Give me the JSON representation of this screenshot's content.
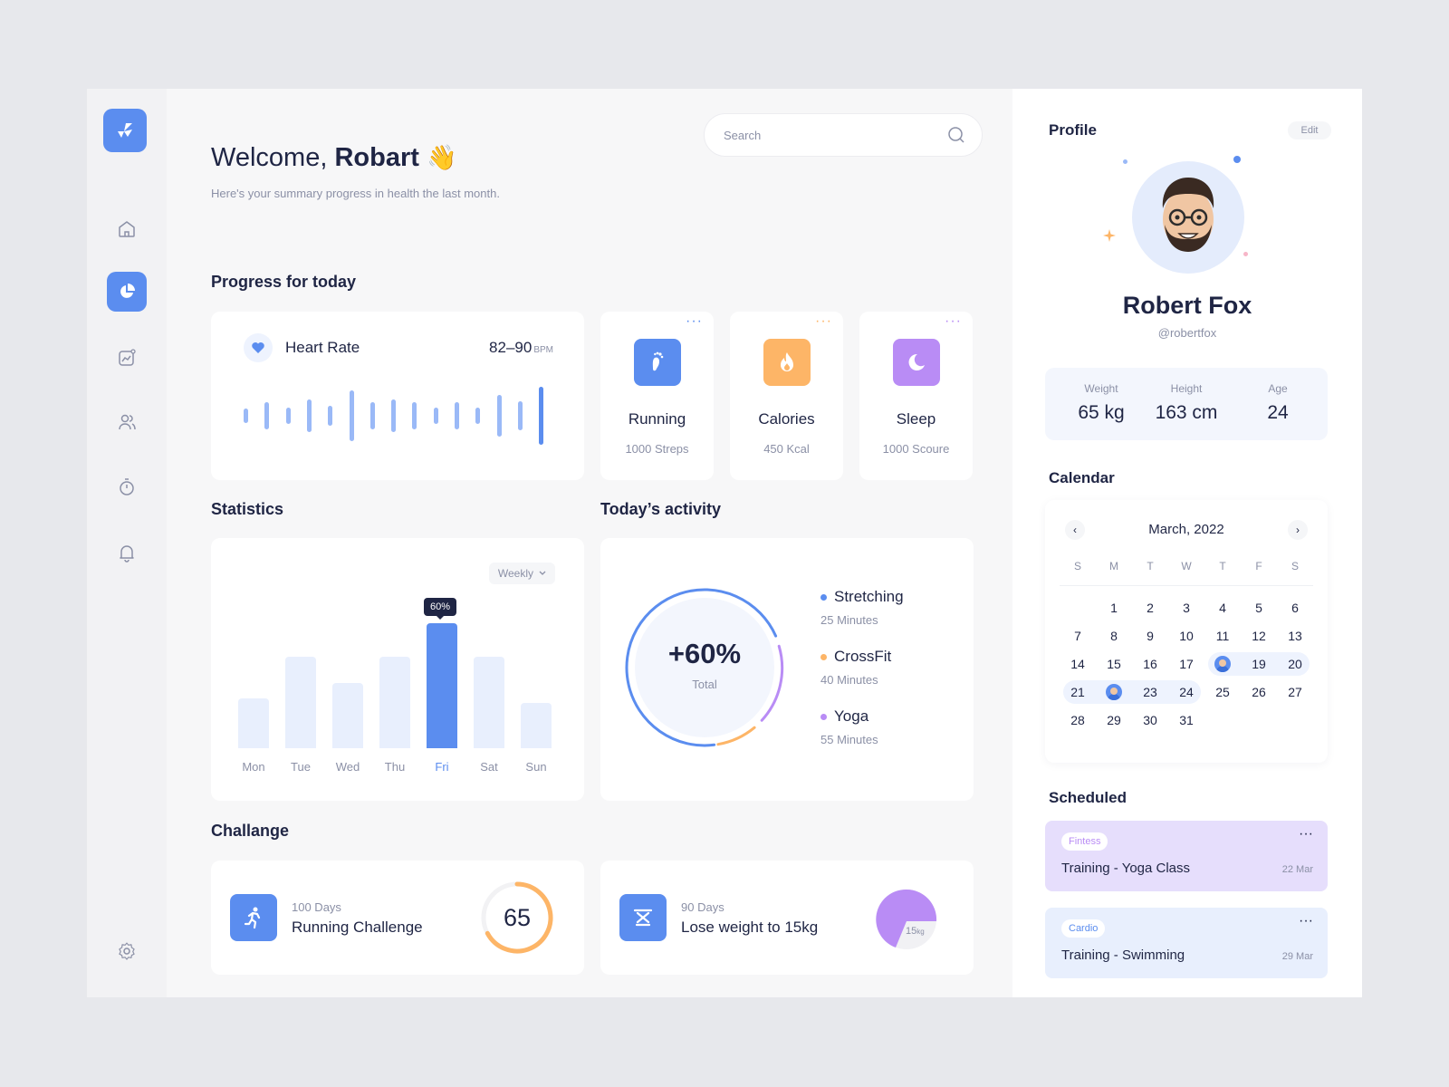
{
  "welcome": {
    "greeting": "Welcome,",
    "name": "Robart",
    "emoji": "👋",
    "subtitle": "Here's your summary progress in health the last month."
  },
  "search": {
    "placeholder": "Search"
  },
  "sidebar": {
    "items": [
      "home-icon",
      "pie-chart-icon",
      "trend-chart-icon",
      "users-icon",
      "timer-icon",
      "bell-icon",
      "settings-icon"
    ],
    "active": "pie-chart-icon"
  },
  "progress": {
    "title": "Progress for today",
    "heart_rate": {
      "label": "Heart Rate",
      "value": "82–90",
      "unit": "BPM"
    },
    "cards": [
      {
        "name": "Running",
        "value": "1000 Streps",
        "color": "#5b8def",
        "icon": "footprint-icon"
      },
      {
        "name": "Calories",
        "value": "450 Kcal",
        "color": "#fdb567",
        "icon": "fire-icon"
      },
      {
        "name": "Sleep",
        "value": "1000 Scoure",
        "color": "#b98cf5",
        "icon": "moon-icon"
      }
    ],
    "more": "···"
  },
  "statistics": {
    "title": "Statistics",
    "filter": "Weekly",
    "tooltip": "60%"
  },
  "chart_data": {
    "type": "bar",
    "categories": [
      "Mon",
      "Tue",
      "Wed",
      "Thu",
      "Fri",
      "Sat",
      "Sun"
    ],
    "values": [
      30,
      55,
      39,
      55,
      75,
      55,
      27
    ],
    "highlight": "Fri",
    "highlight_label": "60%"
  },
  "activity": {
    "title": "Today’s activity",
    "total_value": "+60%",
    "total_label": "Total",
    "items": [
      {
        "name": "Stretching",
        "duration": "25 Minutes",
        "color": "#5b8def"
      },
      {
        "name": "CrossFit",
        "duration": "40 Minutes",
        "color": "#fdb567"
      },
      {
        "name": "Yoga",
        "duration": "55 Minutes",
        "color": "#b98cf5"
      }
    ]
  },
  "challenge": {
    "title": "Challange",
    "items": [
      {
        "days": "100 Days",
        "name": "Running Challenge",
        "value": "65",
        "icon": "running-person-icon"
      },
      {
        "days": "90 Days",
        "name": "Lose weight to 15kg",
        "pie_label": "15",
        "pie_unit": "kg",
        "icon": "scale-icon"
      }
    ]
  },
  "profile": {
    "title": "Profile",
    "edit": "Edit",
    "name": "Robert Fox",
    "handle": "@robertfox",
    "metrics": [
      {
        "label": "Weight",
        "value": "65 kg"
      },
      {
        "label": "Height",
        "value": "163 cm"
      },
      {
        "label": "Age",
        "value": "24"
      }
    ]
  },
  "calendar": {
    "title": "Calendar",
    "month": "March, 2022",
    "dow": [
      "S",
      "M",
      "T",
      "W",
      "T",
      "F",
      "S"
    ],
    "prev": "‹",
    "next": "›"
  },
  "scheduled": {
    "title": "Scheduled",
    "items": [
      {
        "tag": "Fintess",
        "title": "Training - Yoga Class",
        "date": "22 Mar",
        "bg": "#e6defc",
        "tag_color": "#b98cf5"
      },
      {
        "tag": "Cardio",
        "title": "Training - Swimming",
        "date": "29 Mar",
        "bg": "#e8effd",
        "tag_color": "#5b8def"
      }
    ],
    "more": "···"
  }
}
